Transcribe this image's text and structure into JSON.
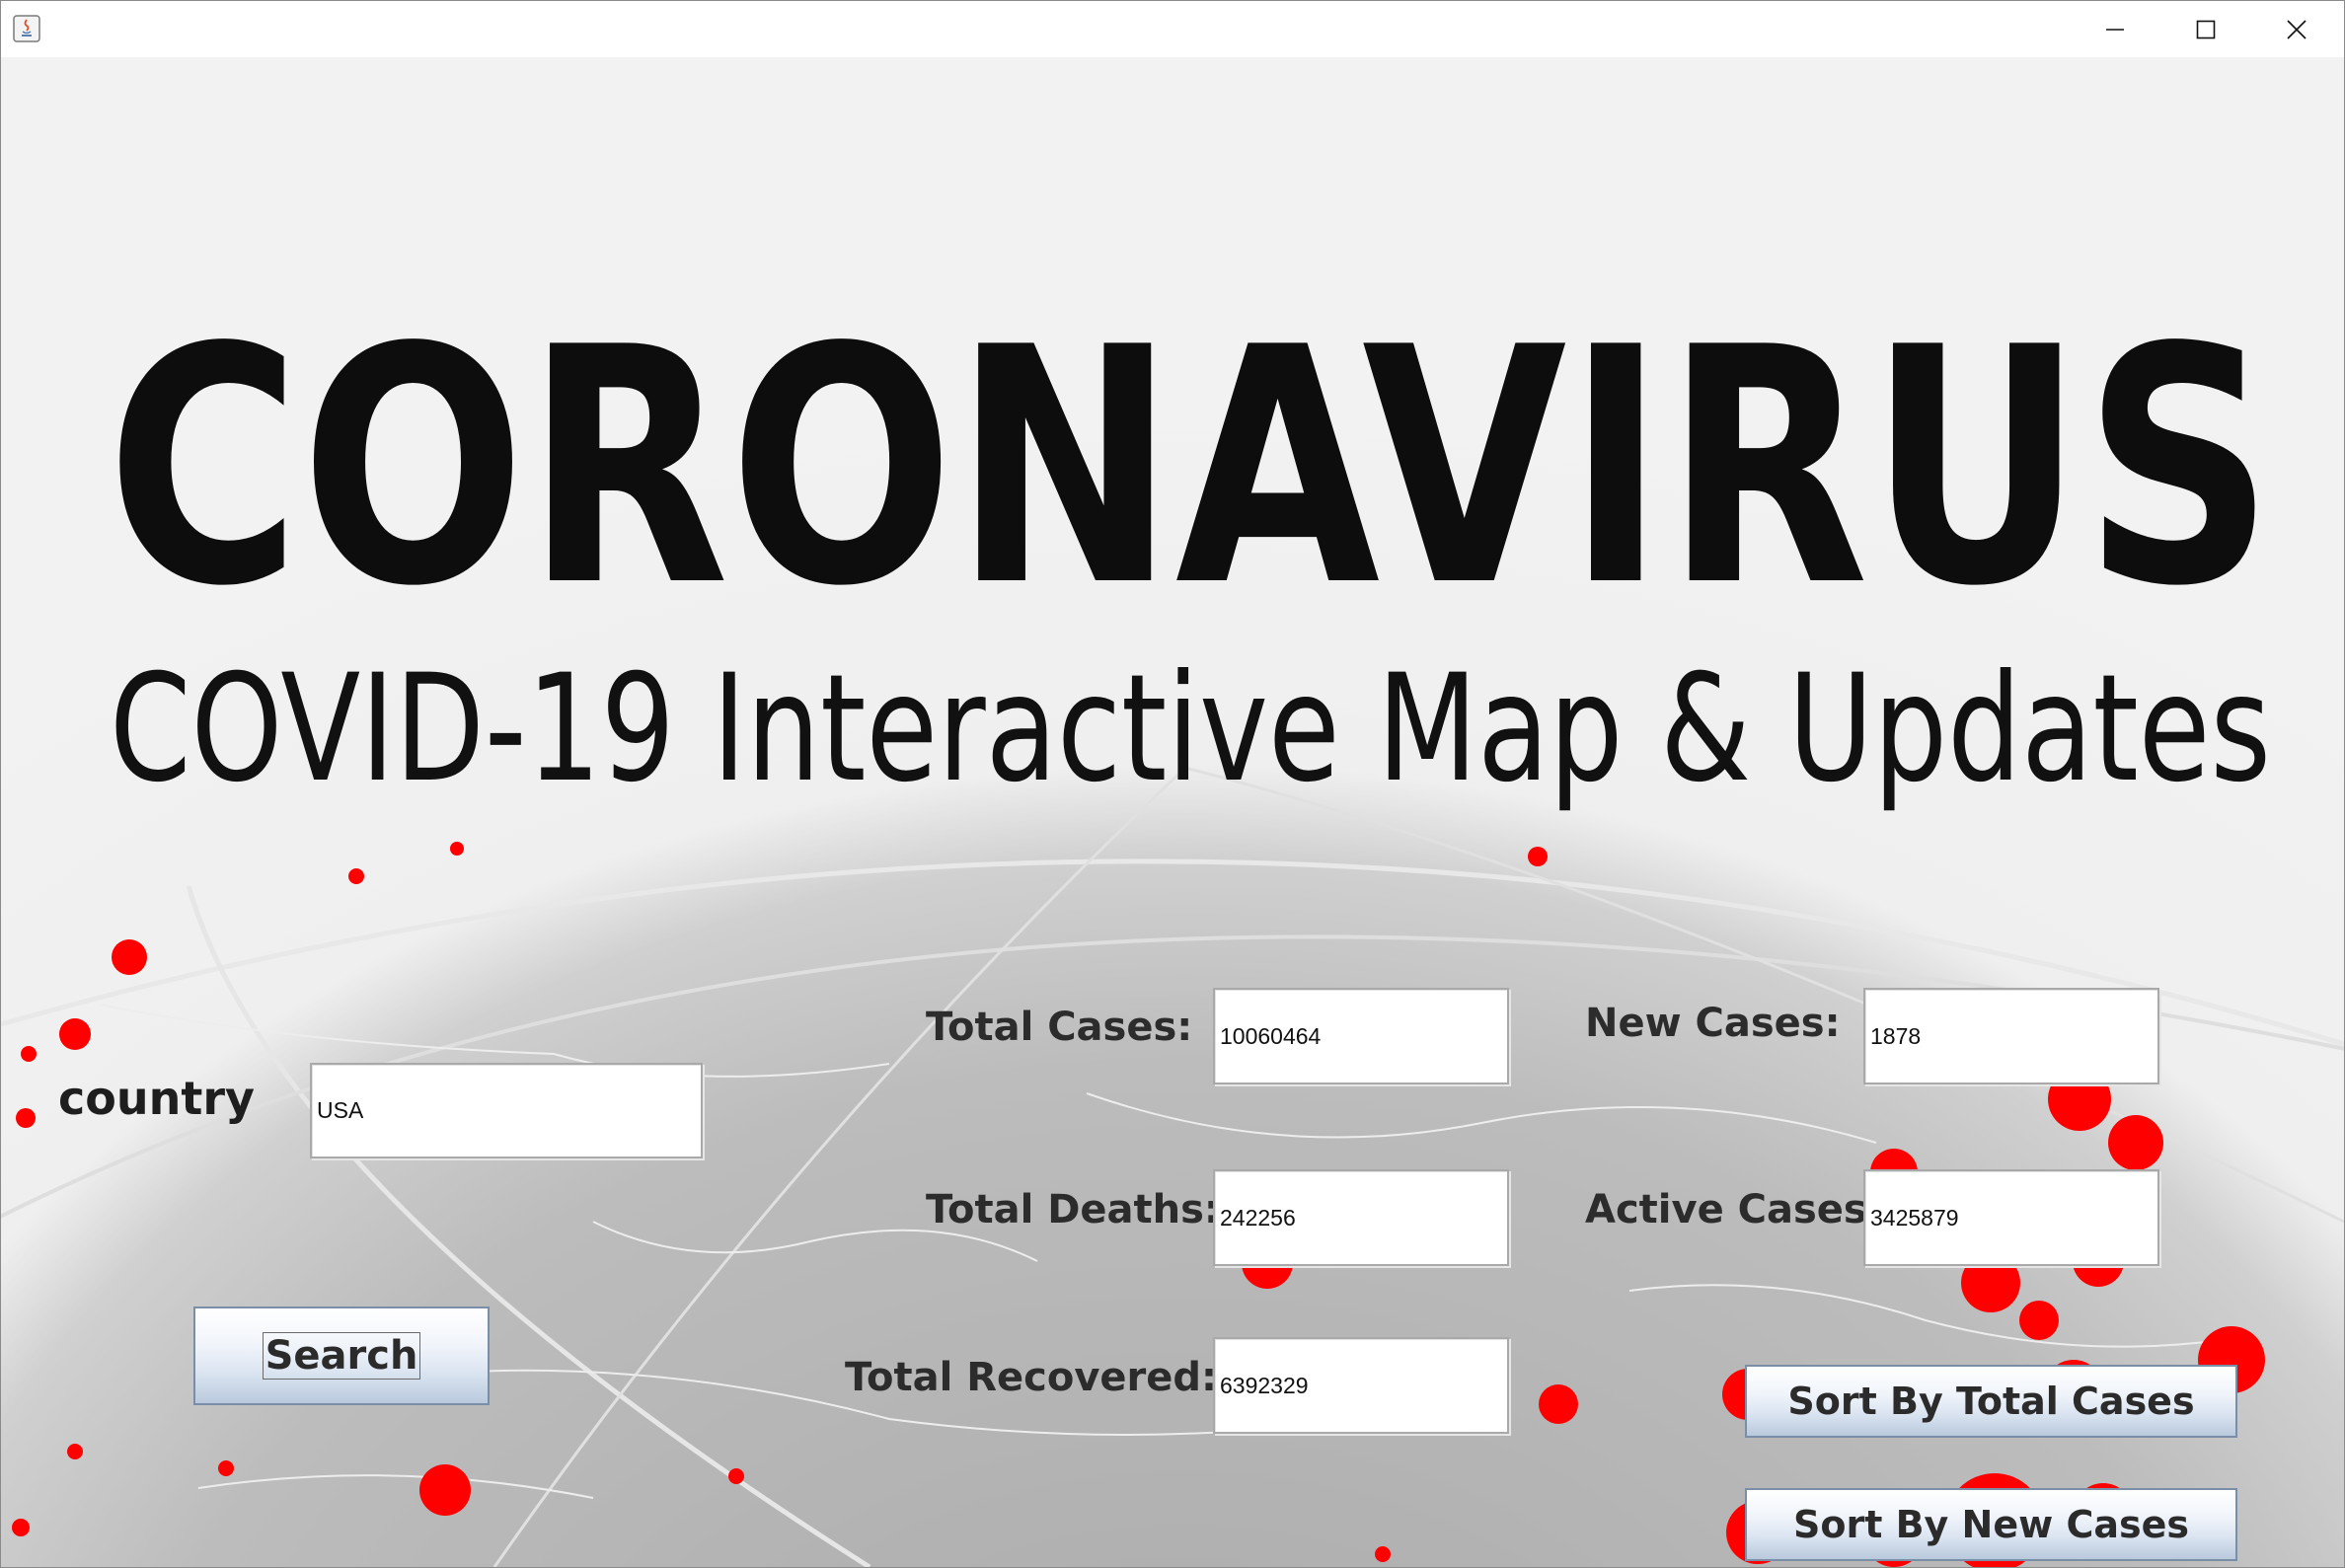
{
  "window": {
    "controls": [
      "minimize-icon",
      "maximize-icon",
      "close-icon"
    ]
  },
  "banner": {
    "title": "CORONAVIRUS",
    "subtitle": "COVID-19 Interactive Map & Updates"
  },
  "search": {
    "country_label": "country",
    "country_value": "USA",
    "search_button": "Search"
  },
  "stats": {
    "total_cases_label": "Total Cases:",
    "total_cases_value": "10060464",
    "new_cases_label": "New Cases:",
    "new_cases_value": "1878",
    "total_deaths_label": "Total Deaths:",
    "total_deaths_value": "242256",
    "active_cases_label": "Active Cases:",
    "active_cases_value": "3425879",
    "total_recovered_label": "Total Recovered:",
    "total_recovered_value": "6392329"
  },
  "actions": {
    "sort_total_cases": "Sort By Total Cases",
    "sort_new_cases": "Sort By New Cases"
  },
  "colors": {
    "hotspot": "#ff0000",
    "title_text": "#0d0d0d",
    "label_text": "#2c2c2c"
  }
}
